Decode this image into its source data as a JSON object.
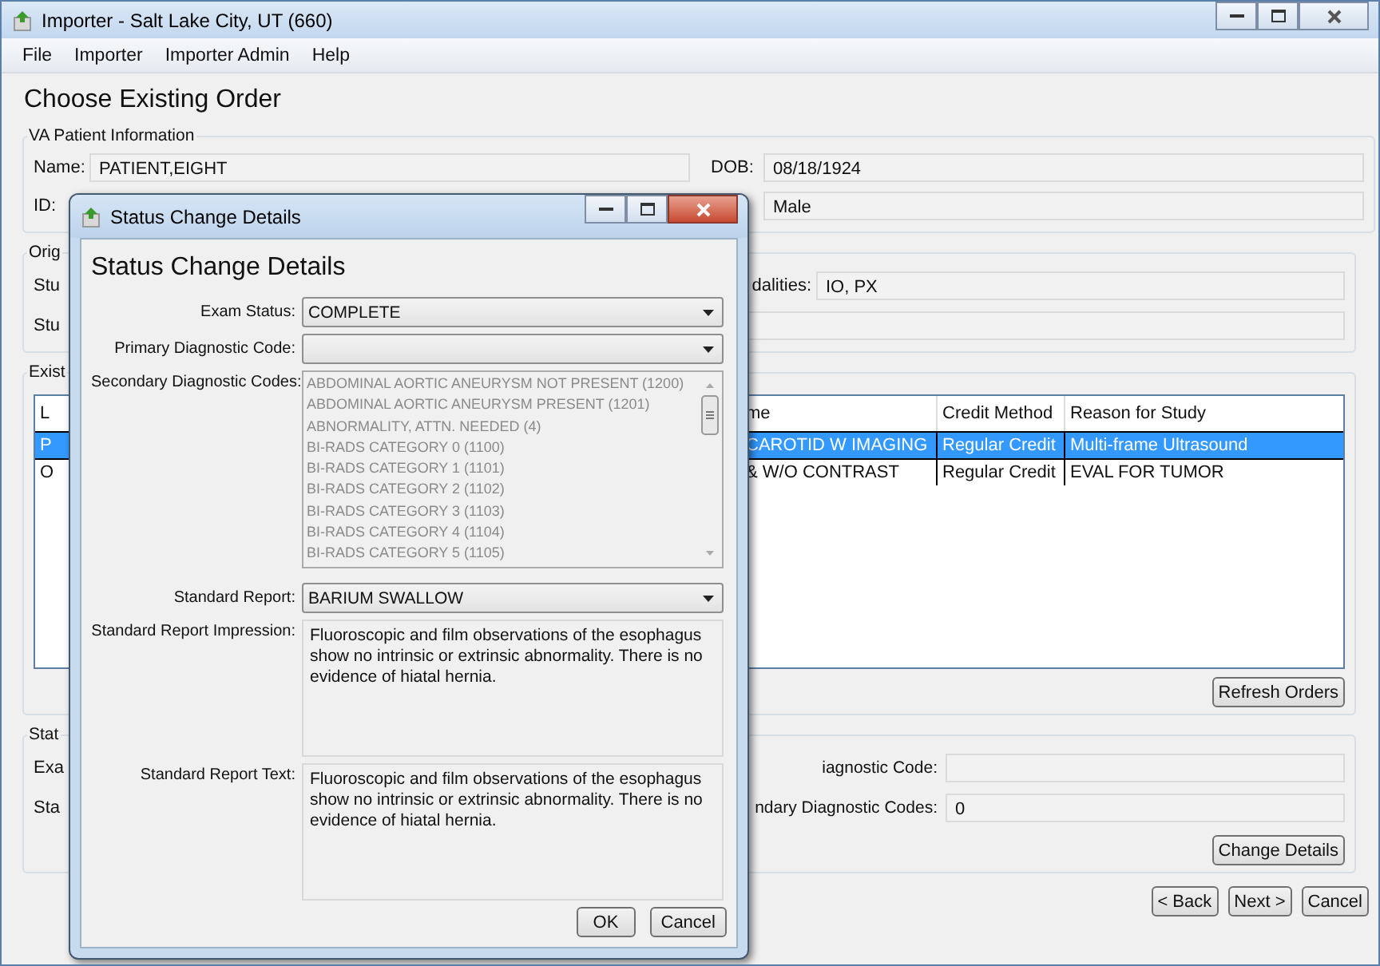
{
  "window": {
    "title": "Importer - Salt Lake City, UT (660)"
  },
  "menu": [
    "File",
    "Importer",
    "Importer Admin",
    "Help"
  ],
  "page_title": "Choose Existing Order",
  "patient_info": {
    "title": "VA Patient Information",
    "name_label": "Name:",
    "name": "PATIENT,EIGHT",
    "dob_label": "DOB:",
    "dob": "08/18/1924",
    "id_label": "ID:",
    "sex": "Male"
  },
  "original_order": {
    "title": "Orig",
    "row_1_label": "Stu",
    "modalities_label": "dalities:",
    "modalities": "IO, PX",
    "row_2_label": "Stu"
  },
  "existing_orders": {
    "title": "Exist",
    "columns": [
      "L",
      "me",
      "Credit Method",
      "Reason for Study"
    ],
    "rows": [
      {
        "cells": [
          "P",
          "CAROTID W IMAGING",
          "Regular Credit",
          "Multi-frame Ultrasound"
        ],
        "selected": true
      },
      {
        "cells": [
          "O",
          "& W/O CONTRAST",
          "Regular Credit",
          "EVAL FOR TUMOR"
        ],
        "selected": false
      }
    ],
    "refresh_button": "Refresh Orders"
  },
  "status": {
    "title": "Stat",
    "row_1_label": "Exa",
    "primary_label": "iagnostic Code:",
    "row_2_label": "Sta",
    "secondary_label": "ndary Diagnostic Codes:",
    "secondary_value": "0",
    "change_button": "Change Details"
  },
  "nav_buttons": [
    "< Back",
    "Next >",
    "Cancel"
  ],
  "dialog": {
    "title": "Status Change Details",
    "heading": "Status Change Details",
    "exam_status_label": "Exam Status:",
    "exam_status": "COMPLETE",
    "primary_code_label": "Primary Diagnostic Code:",
    "secondary_codes_label": "Secondary Diagnostic Codes:",
    "secondary_codes": [
      "ABDOMINAL AORTIC ANEURYSM NOT PRESENT (1200)",
      "ABDOMINAL AORTIC ANEURYSM PRESENT (1201)",
      "ABNORMALITY, ATTN. NEEDED (4)",
      "BI-RADS CATEGORY 0 (1100)",
      "BI-RADS CATEGORY 1 (1101)",
      "BI-RADS CATEGORY 2 (1102)",
      "BI-RADS CATEGORY 3 (1103)",
      "BI-RADS CATEGORY 4 (1104)",
      "BI-RADS CATEGORY 5 (1105)"
    ],
    "standard_report_label": "Standard Report:",
    "standard_report": "BARIUM SWALLOW",
    "impression_label": "Standard Report Impression:",
    "impression": "Fluoroscopic and film observations of the esophagus show no intrinsic or extrinsic abnormality.  There is no evidence of hiatal hernia.",
    "report_text_label": "Standard Report Text:",
    "report_text": "Fluoroscopic and film observations of the esophagus show no intrinsic or extrinsic abnormality.  There is no evidence of hiatal hernia.",
    "buttons": [
      "OK",
      "Cancel"
    ]
  }
}
